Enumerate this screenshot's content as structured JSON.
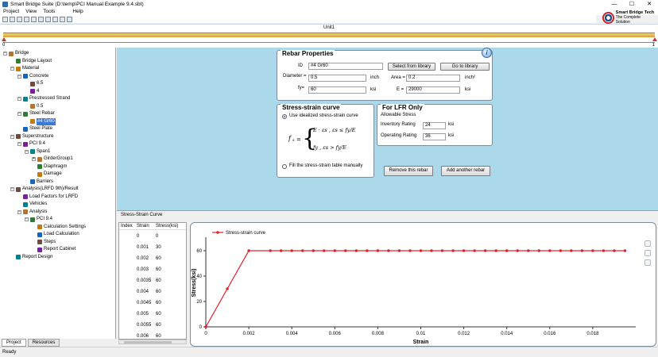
{
  "window": {
    "title": "Smart Bridge Suite (D:\\temp\\PCI Manual Example 9.4.sbt)",
    "minimize": "—",
    "maximize": "☐",
    "close": "✕"
  },
  "menu": [
    "Project",
    "View",
    "Tools",
    "Help"
  ],
  "logo": {
    "name": "Smart Bridge Tech",
    "tagline": "The Complete Solution"
  },
  "unit_bar": {
    "label": "Unit1",
    "start": "0",
    "end": "1"
  },
  "tree": [
    {
      "label": "Bridge",
      "level": 0,
      "icon": "bridge-icon",
      "exp": "−"
    },
    {
      "label": "Bridge Layout",
      "level": 1,
      "icon": "layout-icon"
    },
    {
      "label": "Material",
      "level": 1,
      "icon": "material-icon",
      "exp": "−"
    },
    {
      "label": "Concrete",
      "level": 2,
      "icon": "concrete-icon",
      "exp": "−"
    },
    {
      "label": "6.5",
      "level": 3,
      "icon": "item-icon"
    },
    {
      "label": "4",
      "level": 3,
      "icon": "item-icon"
    },
    {
      "label": "Prestressed Strand",
      "level": 2,
      "icon": "strand-icon",
      "exp": "−"
    },
    {
      "label": "0.5",
      "level": 3,
      "icon": "item-icon"
    },
    {
      "label": "Steel Rebar",
      "level": 2,
      "icon": "rebar-icon",
      "exp": "−"
    },
    {
      "label": "#4 Gr60",
      "level": 3,
      "icon": "item-icon",
      "selected": true
    },
    {
      "label": "Steel Plate",
      "level": 2,
      "icon": "plate-icon"
    },
    {
      "label": "Superstructure",
      "level": 1,
      "icon": "superstructure-icon",
      "exp": "−"
    },
    {
      "label": "PCI 9.4",
      "level": 2,
      "icon": "girder-icon",
      "exp": "−"
    },
    {
      "label": "Span1",
      "level": 3,
      "icon": "span-icon",
      "exp": "−"
    },
    {
      "label": "GirderGroup1",
      "level": 4,
      "icon": "girder-group-icon",
      "exp": "+"
    },
    {
      "label": "Diaphragm",
      "level": 4,
      "icon": "diaphragm-icon"
    },
    {
      "label": "Damage",
      "level": 4,
      "icon": "damage-icon"
    },
    {
      "label": "Barriers",
      "level": 3,
      "icon": "barrier-icon"
    },
    {
      "label": "Analysis(LRFD 9th)/Result",
      "level": 1,
      "icon": "analysis-icon",
      "exp": "−"
    },
    {
      "label": "Load Factors for LRFD",
      "level": 2,
      "icon": "load-factors-icon"
    },
    {
      "label": "Vehicles",
      "level": 2,
      "icon": "vehicles-icon"
    },
    {
      "label": "Analysis",
      "level": 2,
      "icon": "analysis-sub-icon",
      "exp": "−"
    },
    {
      "label": "PCI 9.4",
      "level": 3,
      "icon": "girder-icon",
      "exp": "−"
    },
    {
      "label": "Calculation Settings",
      "level": 4,
      "icon": "settings-icon"
    },
    {
      "label": "Load Calculation",
      "level": 4,
      "icon": "load-calc-icon"
    },
    {
      "label": "Steps",
      "level": 4,
      "icon": "steps-icon"
    },
    {
      "label": "Report Cabinet",
      "level": 4,
      "icon": "cabinet-icon"
    },
    {
      "label": "Report Design",
      "level": 1,
      "icon": "report-icon"
    }
  ],
  "bottom_tabs": [
    "Project",
    "Resources"
  ],
  "status": "Ready",
  "rebar": {
    "title": "Rebar Properties",
    "id_label": "ID",
    "id_value": "#4 Gr60",
    "select_lib": "Select from library",
    "goto_lib": "Go to library",
    "diameter_label": "Diameter =",
    "diameter_value": "0.5",
    "diameter_unit": "inch",
    "area_label": "Area =",
    "area_value": "0.2",
    "area_unit": "inch²",
    "fy_label": "fy=",
    "fy_value": "60",
    "fy_unit": "ksi",
    "e_label": "E =",
    "e_value": "29000",
    "e_unit": "ksi"
  },
  "ss_curve": {
    "title": "Stress-strain curve",
    "opt1": "Use idealized stress-strain curve",
    "opt2": "Fill the stress-strain table manually",
    "eq_fs": "f",
    "eq_line1": "E · εs ,    εs ≤ fy/E",
    "eq_line2": "fy ,    εs > fy/E"
  },
  "lfr": {
    "title": "For LFR Only",
    "allowable": "Allowable Stress",
    "inv_label": "Inventory Rating",
    "inv_value": "24",
    "inv_unit": "ksi",
    "op_label": "Operating Rating",
    "op_value": "36",
    "op_unit": "ksi"
  },
  "buttons": {
    "remove": "Remove this rebar",
    "add": "Add another rebar"
  },
  "table": {
    "panel_title": "Stress-Strain Curve",
    "headers": [
      "Index",
      "Strain",
      "Stress(ksi)"
    ],
    "rows": [
      [
        "",
        "0",
        "0"
      ],
      [
        "",
        "0.001",
        "30"
      ],
      [
        "",
        "0.002",
        "60"
      ],
      [
        "",
        "0.003",
        "60"
      ],
      [
        "",
        "0.0035",
        "60"
      ],
      [
        "",
        "0.004",
        "60"
      ],
      [
        "",
        "0.0045",
        "60"
      ],
      [
        "",
        "0.005",
        "60"
      ],
      [
        "",
        "0.0055",
        "60"
      ],
      [
        "",
        "0.006",
        "60"
      ],
      [
        "",
        "0.0065",
        "60"
      ]
    ]
  },
  "chart_data": {
    "type": "line",
    "title": "",
    "xlabel": "Strain",
    "ylabel": "Stress(ksi)",
    "xlim": [
      0,
      0.02
    ],
    "ylim": [
      0,
      60
    ],
    "xticks": [
      "0",
      "0.002",
      "0.004",
      "0.006",
      "0.008",
      "0.01",
      "0.012",
      "0.014",
      "0.016",
      "0.018"
    ],
    "xtick_values": [
      0,
      0.002,
      0.004,
      0.006,
      0.008,
      0.01,
      0.012,
      0.014,
      0.016,
      0.018
    ],
    "yticks": [
      "0",
      "20",
      "40",
      "60"
    ],
    "ytick_values": [
      0,
      20,
      40,
      60
    ],
    "legend": "top-left",
    "grid": false,
    "series": [
      {
        "name": "Stress-strain curve",
        "color": "#e0202a",
        "x": [
          0,
          0.001,
          0.002,
          0.003,
          0.0035,
          0.004,
          0.0045,
          0.005,
          0.0055,
          0.006,
          0.0065,
          0.007,
          0.0075,
          0.008,
          0.0085,
          0.009,
          0.0095,
          0.01,
          0.0105,
          0.011,
          0.0115,
          0.012,
          0.0125,
          0.013,
          0.0135,
          0.014,
          0.0145,
          0.015,
          0.0155,
          0.016,
          0.0165,
          0.017,
          0.0175,
          0.018,
          0.0185,
          0.019,
          0.0195
        ],
        "y": [
          0,
          30,
          60,
          60,
          60,
          60,
          60,
          60,
          60,
          60,
          60,
          60,
          60,
          60,
          60,
          60,
          60,
          60,
          60,
          60,
          60,
          60,
          60,
          60,
          60,
          60,
          60,
          60,
          60,
          60,
          60,
          60,
          60,
          60,
          60,
          60,
          60
        ]
      }
    ]
  }
}
